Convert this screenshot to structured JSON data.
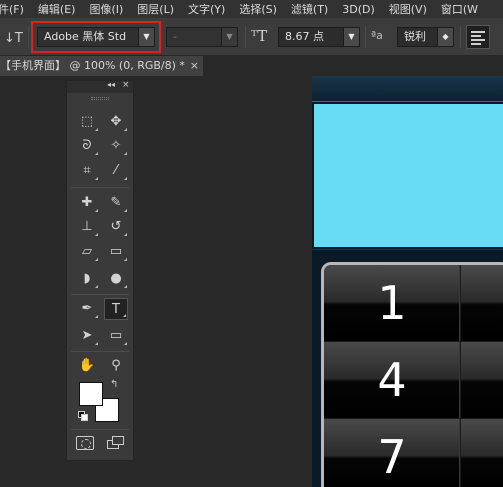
{
  "menubar": {
    "items": [
      "件(F)",
      "编辑(E)",
      "图像(I)",
      "图层(L)",
      "文字(Y)",
      "选择(S)",
      "滤镜(T)",
      "3D(D)",
      "视图(V)",
      "窗口(W"
    ]
  },
  "options": {
    "font_family": "Adobe 黑体 Std",
    "font_style": "-",
    "font_size": "8.67 点",
    "antialias_icon_text": "ªa",
    "antialias": "锐利",
    "tool_preset_icon": "type-tool-icon",
    "highlight_color": "#e0201c"
  },
  "tab": {
    "title": "【手机界面】 @ 100% (0, RGB/8) *",
    "close": "×"
  },
  "document": {
    "screen_color": "#66ddf5",
    "keys": [
      "1",
      "4",
      "7"
    ]
  },
  "tools": {
    "header_collapse": "◂◂",
    "header_close": "×",
    "items": [
      {
        "name": "marquee-tool-icon",
        "glyph": "⬚"
      },
      {
        "name": "move-tool-icon",
        "glyph": "✥"
      },
      {
        "name": "lasso-tool-icon",
        "glyph": "ᘐ"
      },
      {
        "name": "magic-wand-tool-icon",
        "glyph": "✧"
      },
      {
        "name": "crop-tool-icon",
        "glyph": "⌗"
      },
      {
        "name": "eyedropper-tool-icon",
        "glyph": "⁄"
      },
      {
        "name": "healing-brush-tool-icon",
        "glyph": "✚"
      },
      {
        "name": "brush-tool-icon",
        "glyph": "✎"
      },
      {
        "name": "clone-stamp-tool-icon",
        "glyph": "⊥"
      },
      {
        "name": "history-brush-tool-icon",
        "glyph": "↺"
      },
      {
        "name": "eraser-tool-icon",
        "glyph": "▱"
      },
      {
        "name": "gradient-tool-icon",
        "glyph": "▭"
      },
      {
        "name": "blur-tool-icon",
        "glyph": "◗"
      },
      {
        "name": "dodge-tool-icon",
        "glyph": "●"
      },
      {
        "name": "pen-tool-icon",
        "glyph": "✒"
      },
      {
        "name": "type-tool-icon",
        "glyph": "T"
      },
      {
        "name": "path-selection-tool-icon",
        "glyph": "➤"
      },
      {
        "name": "rectangle-tool-icon",
        "glyph": "▭"
      },
      {
        "name": "hand-tool-icon",
        "glyph": "✋"
      },
      {
        "name": "zoom-tool-icon",
        "glyph": "⚲"
      }
    ],
    "active": "type-tool-icon",
    "foreground_color": "#ffffff",
    "background_color": "#ffffff",
    "swap_glyph": "↰"
  }
}
